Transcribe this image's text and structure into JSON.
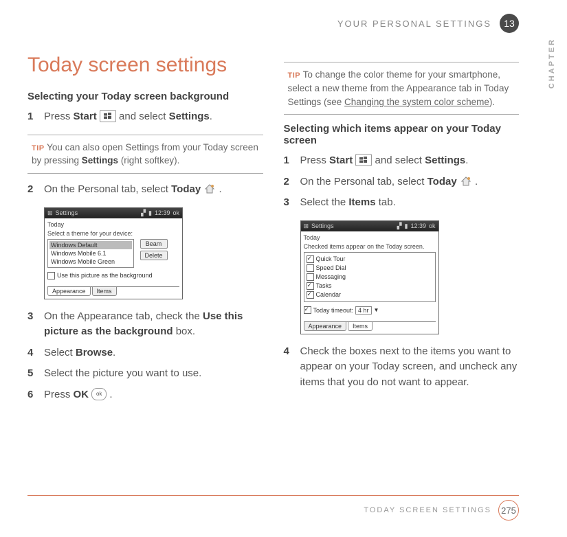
{
  "header": {
    "section": "YOUR PERSONAL SETTINGS",
    "chapter_num": "13",
    "side_label": "CHAPTER"
  },
  "footer": {
    "section": "TODAY SCREEN SETTINGS",
    "page": "275"
  },
  "title": "Today screen settings",
  "left": {
    "subhead_a": "Selecting your Today screen background",
    "step1_pre": "Press ",
    "step1_b1": "Start",
    "step1_mid": " and select ",
    "step1_b2": "Settings",
    "step1_post": ".",
    "tip_label": "TIP",
    "tip_text_a": " You can also open Settings from your Today screen by pressing ",
    "tip_bold": "Settings",
    "tip_text_b": " (right softkey).",
    "step2_pre": "On the Personal tab, select ",
    "step2_b": "Today",
    "step2_post": " .",
    "step3_pre": "On the Appearance tab, check the ",
    "step3_b": "Use this picture as the background",
    "step3_post": " box.",
    "step4_pre": "Select ",
    "step4_b": "Browse",
    "step4_post": ".",
    "step5": "Select the picture you want to use.",
    "step6_pre": "Press ",
    "step6_b": "OK",
    "step6_post": " .",
    "ss": {
      "title": "Settings",
      "time": "12:39",
      "tab_header": "Today",
      "prompt": "Select a theme for your device:",
      "opt1": "Windows Default",
      "opt2": "Windows Mobile 6.1",
      "opt3": "Windows Mobile Green",
      "btn_beam": "Beam",
      "btn_delete": "Delete",
      "check_label": "Use this picture as the background",
      "tab1": "Appearance",
      "tab2": "Items"
    }
  },
  "right": {
    "tip_label": "TIP",
    "tip_text_a": " To change the color theme for your smartphone, select a new theme from the Appearance tab in Today Settings (see ",
    "tip_link": "Changing the system color scheme",
    "tip_text_b": ").",
    "subhead": "Selecting which items appear on your Today screen",
    "step1_pre": "Press ",
    "step1_b1": "Start",
    "step1_mid": " and select ",
    "step1_b2": "Settings",
    "step1_post": ".",
    "step2_pre": "On the Personal tab, select ",
    "step2_b": "Today",
    "step2_post": " .",
    "step3_pre": "Select the ",
    "step3_b": "Items",
    "step3_post": " tab.",
    "step4": "Check the boxes next to the items you want to appear on your Today screen, and uncheck any items that you do not want to appear.",
    "ss": {
      "title": "Settings",
      "time": "12:39",
      "tab_header": "Today",
      "prompt": "Checked items appear on the Today screen.",
      "i1": "Quick Tour",
      "i2": "Speed Dial",
      "i3": "Messaging",
      "i4": "Tasks",
      "i5": "Calendar",
      "timeout_label": "Today timeout:",
      "timeout_val": "4 hr",
      "tab1": "Appearance",
      "tab2": "Items"
    }
  }
}
